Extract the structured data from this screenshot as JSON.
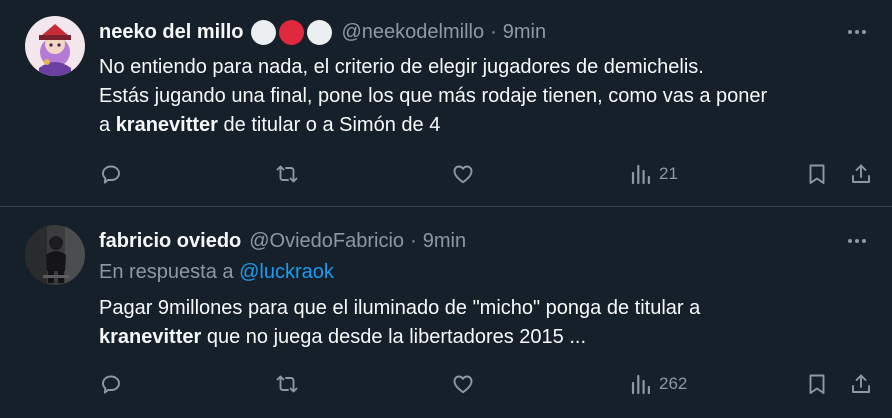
{
  "tweets": [
    {
      "name": "neeko del millo",
      "handle": "@neekodelmillo",
      "time": "9min",
      "text_line1": "No entiendo para nada, el criterio de elegir jugadores de demichelis.",
      "text_line2": "Estás jugando una final, pone los que más rodaje tienen, como vas a poner",
      "text_line3_pre": "a ",
      "text_line3_bold": "kranevitter",
      "text_line3_post": " de titular o a Simón de 4",
      "views": "21",
      "badge_colors": [
        "#eceff1",
        "#e0283f",
        "#eceff1"
      ]
    },
    {
      "name": "fabricio oviedo",
      "handle": "@OviedoFabricio",
      "time": "9min",
      "reply_prefix": "En respuesta a ",
      "reply_handle": "@luckraok",
      "text_line1": "Pagar 9millones para que el iluminado de \"micho\" ponga de titular a",
      "text_line2_bold": "kranevitter",
      "text_line2_post": " que no juega desde la libertadores 2015 ...",
      "views": "262"
    }
  ],
  "dot": "·",
  "colors": {
    "background": "#15202b",
    "text": "#f7f9f9",
    "muted": "#8b98a5",
    "link": "#1d9bf0",
    "divider": "#38444d"
  }
}
